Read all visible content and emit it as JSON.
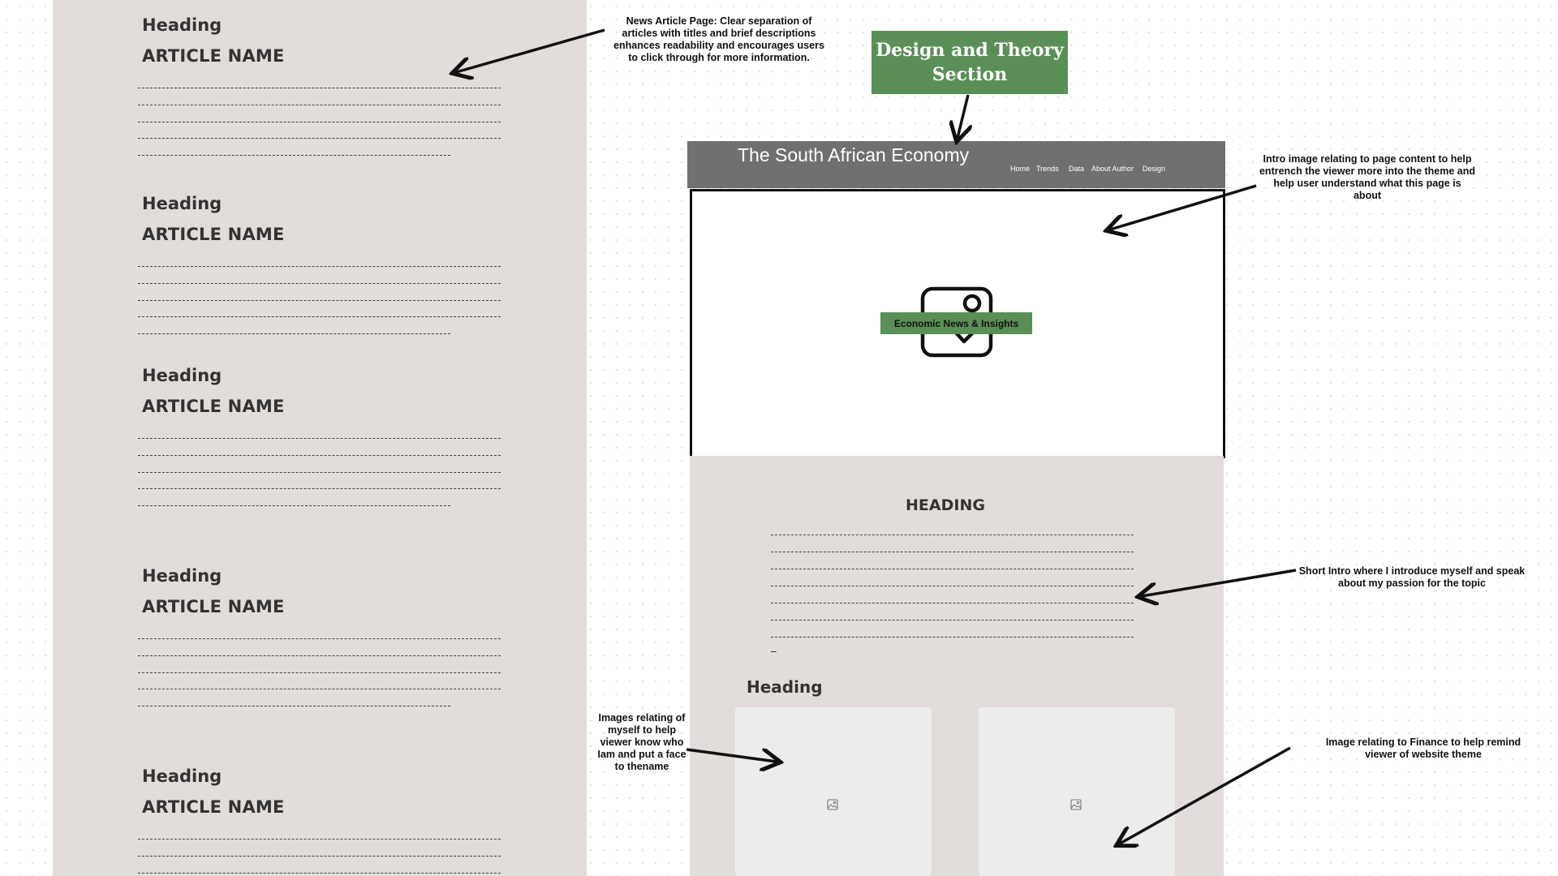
{
  "news_page": {
    "articles": [
      {
        "heading": "Heading",
        "name": "ARTICLE NAME"
      },
      {
        "heading": "Heading",
        "name": "ARTICLE NAME"
      },
      {
        "heading": "Heading",
        "name": "ARTICLE NAME"
      },
      {
        "heading": "Heading",
        "name": "ARTICLE NAME"
      },
      {
        "heading": "Heading",
        "name": "ARTICLE NAME"
      }
    ]
  },
  "annotations": {
    "news_article": "News Article Page: Clear separation of articles with titles and brief descriptions enhances readability and encourages users to click through for more information.",
    "intro_image": "Intro image relating to page content to help entrench the viewer more into the theme and help user understand what this page is about",
    "short_intro": "Short Intro where I introduce myself and speak about my passion for the topic",
    "images_myself": "Images relating of myself to help viewer know who Iam and put a face to thename",
    "finance_image": "Image relating to Finance to help remind viewer of website theme"
  },
  "design_box": {
    "line1": "Design and Theory",
    "line2": "Section"
  },
  "mockup": {
    "site_title": "The South African Economy",
    "nav": [
      "Home",
      "Trends",
      "Data",
      "About Author",
      "Design"
    ],
    "hero_badge": "Economic News & Insights",
    "intro_heading": "HEADING",
    "section_heading": "Heading",
    "intro_trailing_dash": "_"
  },
  "colors": {
    "panel": "#e2dddb",
    "accent_green": "#5a8f57",
    "nav_gray": "#707070"
  },
  "icons": [
    "image-placeholder-icon",
    "arrow-icon"
  ]
}
